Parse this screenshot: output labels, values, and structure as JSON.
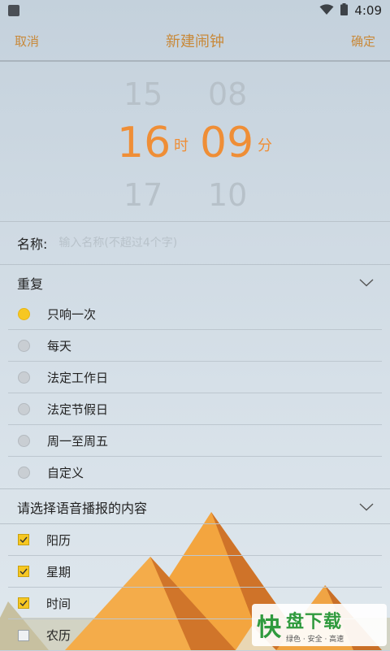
{
  "status": {
    "time": "4:09"
  },
  "header": {
    "cancel": "取消",
    "title": "新建闹钟",
    "confirm": "确定"
  },
  "picker": {
    "hour_prev": "15",
    "hour": "16",
    "hour_next": "17",
    "hour_unit": "时",
    "minute_prev": "08",
    "minute": "09",
    "minute_next": "10",
    "minute_unit": "分"
  },
  "name_field": {
    "label": "名称:",
    "placeholder": "输入名称(不超过4个字)",
    "value": ""
  },
  "repeat": {
    "title": "重复",
    "options": [
      {
        "label": "只响一次",
        "selected": true
      },
      {
        "label": "每天",
        "selected": false
      },
      {
        "label": "法定工作日",
        "selected": false
      },
      {
        "label": "法定节假日",
        "selected": false
      },
      {
        "label": "周一至周五",
        "selected": false
      },
      {
        "label": "自定义",
        "selected": false
      }
    ]
  },
  "voice": {
    "title": "请选择语音播报的内容",
    "options": [
      {
        "label": "阳历",
        "checked": true
      },
      {
        "label": "星期",
        "checked": true
      },
      {
        "label": "时间",
        "checked": true
      },
      {
        "label": "农历",
        "checked": false
      }
    ]
  },
  "watermark": {
    "logo": "快",
    "name": "盘下载",
    "slogan": "绿色 · 安全 · 高速"
  },
  "colors": {
    "accent": "#ef8e36",
    "header_text": "#c8893a",
    "radio_selected": "#f6c722"
  }
}
